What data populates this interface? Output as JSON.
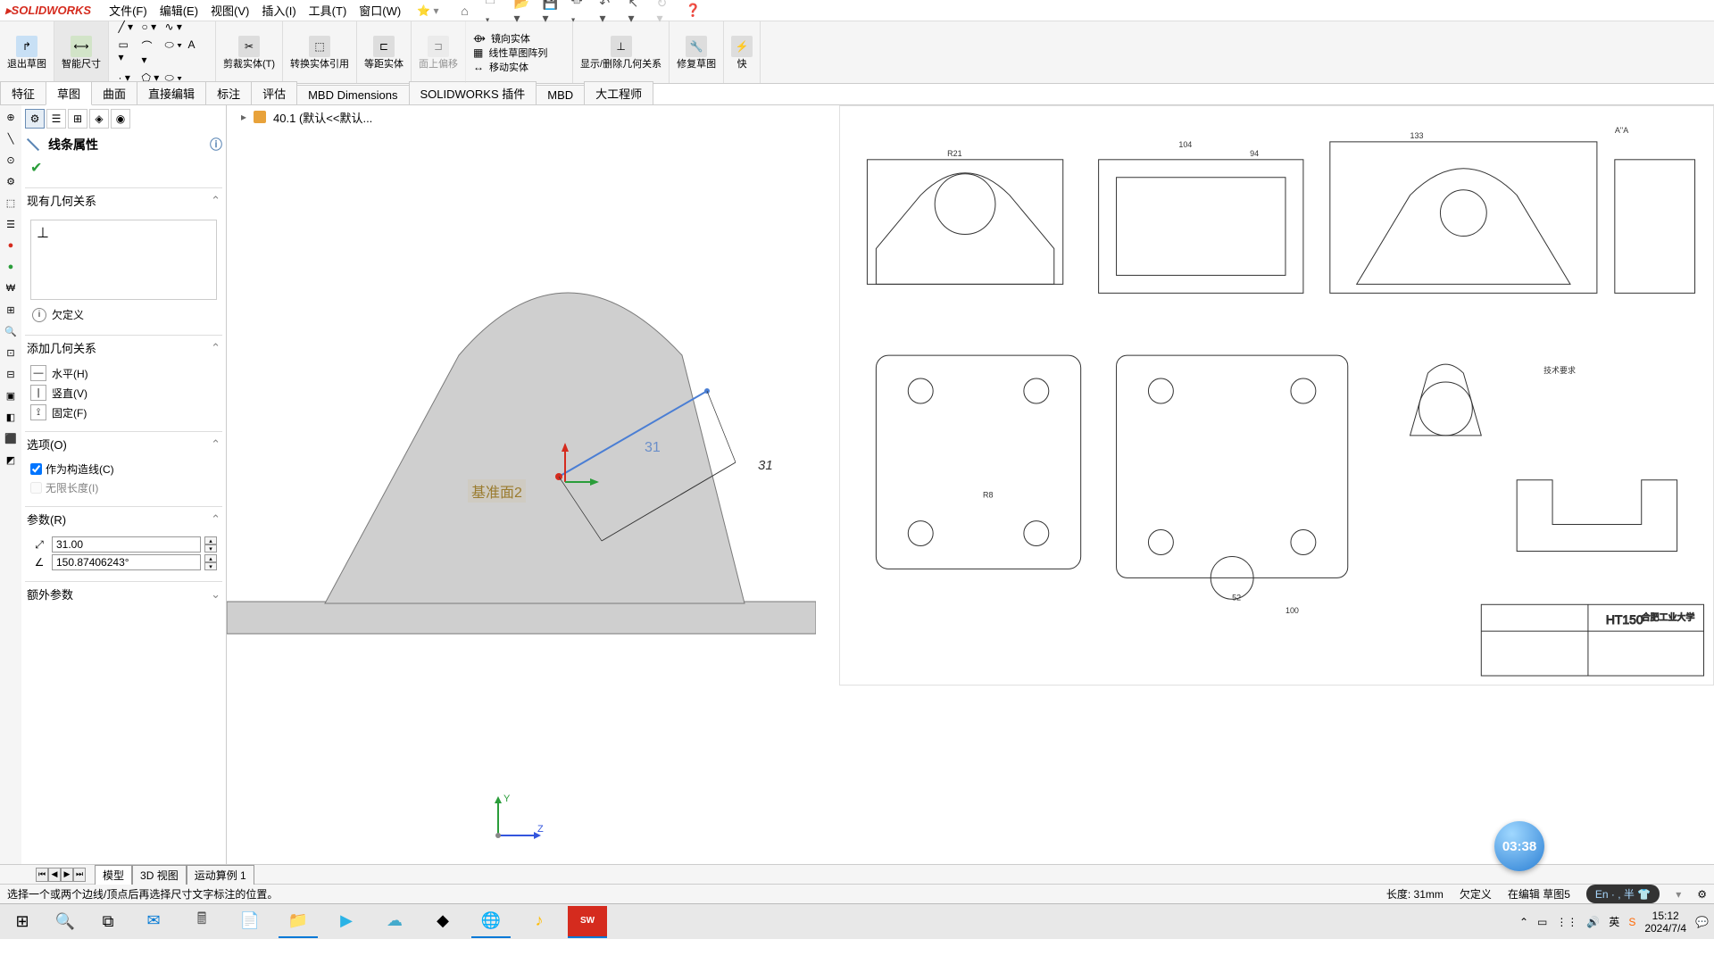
{
  "app": {
    "logo_text": "SOLIDWORKS"
  },
  "menubar": [
    "文件(F)",
    "编辑(E)",
    "视图(V)",
    "插入(I)",
    "工具(T)",
    "窗口(W)"
  ],
  "qat_icons": [
    "home",
    "new",
    "open",
    "save",
    "print",
    "undo",
    "redo",
    "rebuild"
  ],
  "ribbon": {
    "groups": [
      {
        "label": "退出草图",
        "icon": "exit-sketch"
      },
      {
        "label": "智能尺寸",
        "icon": "smart-dim"
      },
      {
        "label": "",
        "mini_grid": true
      },
      {
        "label": "剪裁实体(T)",
        "icon": "trim"
      },
      {
        "label": "转换实体引用",
        "icon": "convert"
      },
      {
        "label": "等距实体",
        "icon": "offset"
      },
      {
        "label": "面上偏移",
        "icon": "surf-offset",
        "disabled": true
      },
      {
        "label": "镜向实体",
        "icon": "mirror",
        "sub": [
          "线性草图阵列",
          "移动实体"
        ]
      },
      {
        "label": "显示/删除几何关系",
        "icon": "relations"
      },
      {
        "label": "修复草图",
        "icon": "repair"
      },
      {
        "label": "快",
        "icon": "quick"
      }
    ]
  },
  "tabs": [
    "特征",
    "草图",
    "曲面",
    "直接编辑",
    "标注",
    "评估",
    "MBD Dimensions",
    "SOLIDWORKS 插件",
    "MBD",
    "大工程师"
  ],
  "active_tab": 1,
  "breadcrumb": {
    "part_name": "40.1  (默认<<默认..."
  },
  "prop_panel": {
    "title": "线条属性",
    "sec_relations": "现有几何关系",
    "status_text": "欠定义",
    "sec_add": "添加几何关系",
    "btn_horiz": "水平(H)",
    "btn_vert": "竖直(V)",
    "btn_fix": "固定(F)",
    "sec_options": "选项(O)",
    "chk_construction": "作为构造线(C)",
    "chk_infinite": "无限长度(I)",
    "sec_params": "参数(R)",
    "param_length": "31.00",
    "param_angle": "150.87406243°",
    "sec_extra": "额外参数"
  },
  "canvas": {
    "datum_label": "基准面2",
    "dim_text": "31",
    "dim_val": "31",
    "y_label": "Y",
    "z_label": "Z"
  },
  "badge_time": "03:38",
  "sheet_tabs": [
    "模型",
    "3D 视图",
    "运动算例 1"
  ],
  "status": {
    "left": "选择一个或两个边线/顶点后再选择尺寸文字标注的位置。",
    "length": "长度: 31mm",
    "def": "欠定义",
    "editing": "在编辑 草图5",
    "lang_pill": "En · , 半 👕"
  },
  "taskbar": {
    "time": "15:12",
    "date": "2024/7/4",
    "ime": "英",
    "apps": [
      "start",
      "search",
      "taskview",
      "mail",
      "store",
      "files",
      "explorer",
      "video",
      "cloud",
      "copilot",
      "edge",
      "music",
      "sw"
    ]
  }
}
